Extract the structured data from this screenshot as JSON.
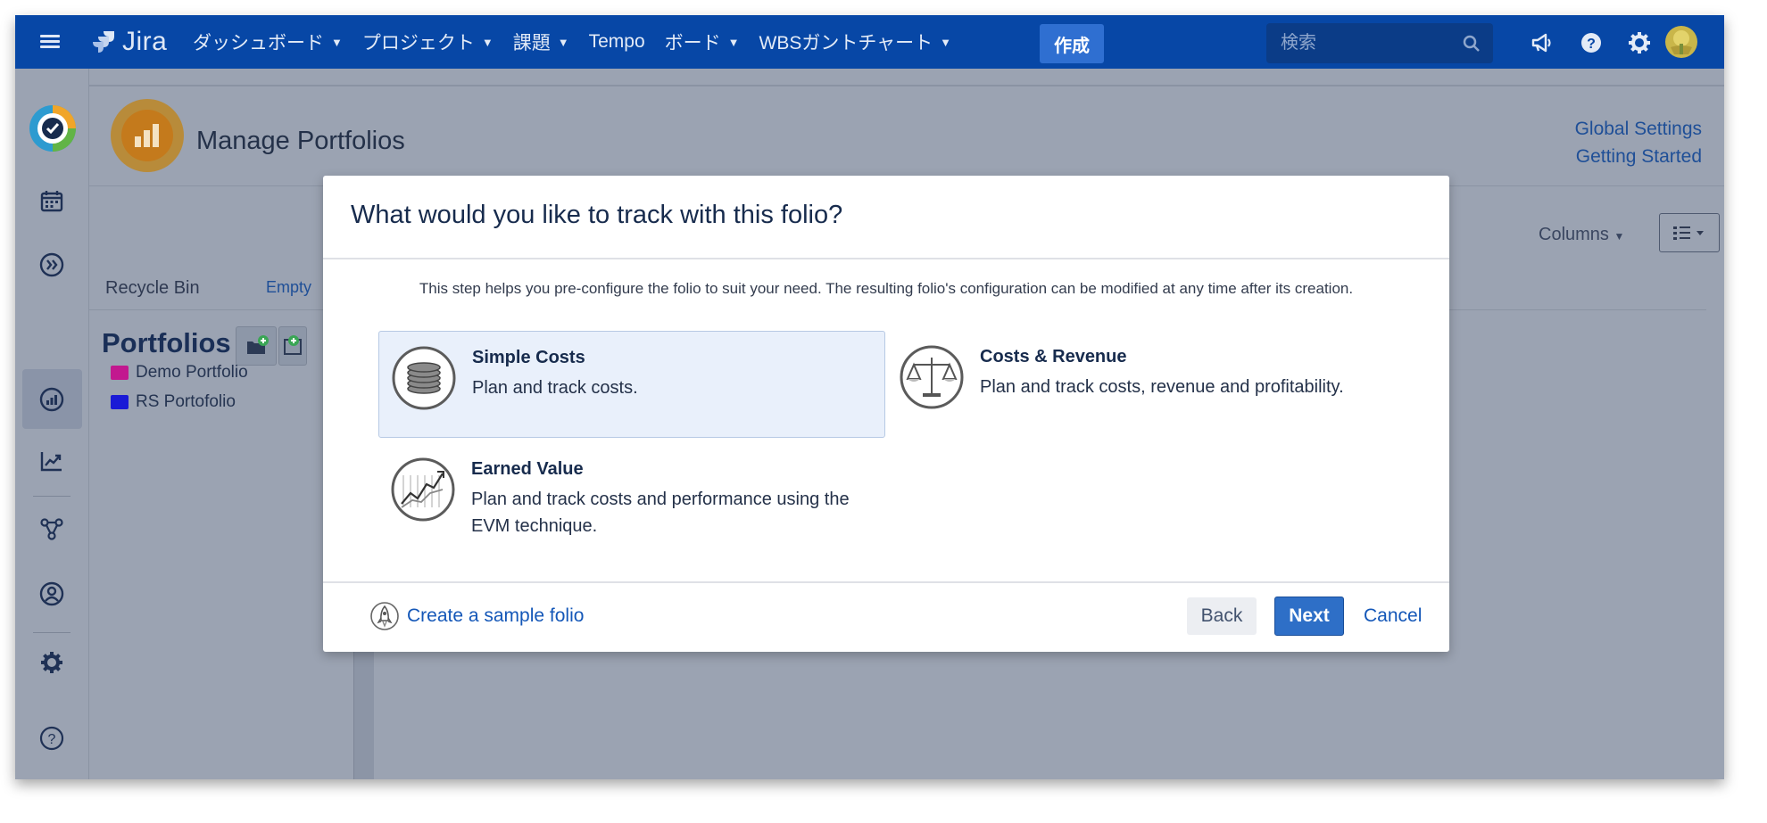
{
  "topnav": {
    "logo_text": "Jira",
    "items": [
      {
        "label": "ダッシュボード",
        "has_menu": true
      },
      {
        "label": "プロジェクト",
        "has_menu": true
      },
      {
        "label": "課題",
        "has_menu": true
      },
      {
        "label": "Tempo",
        "has_menu": false
      },
      {
        "label": "ボード",
        "has_menu": true
      },
      {
        "label": "WBSガントチャート",
        "has_menu": true
      }
    ],
    "create_label": "作成",
    "search_placeholder": "検索",
    "accent": "#0747a6"
  },
  "header": {
    "title": "Manage Portfolios",
    "links": [
      "Global Settings",
      "Getting Started"
    ]
  },
  "toolbar": {
    "columns_label": "Columns"
  },
  "left_panel": {
    "recycle_bin": "Recycle Bin",
    "empty_link": "Empty",
    "heading": "Portfolios",
    "tree": [
      {
        "label": "Demo Portfolio",
        "color": "#c2188f"
      },
      {
        "label": "RS Portofolio",
        "color": "#1a1ad6"
      }
    ]
  },
  "dialog": {
    "title": "What would you like to track with this folio?",
    "description": "This step helps you pre-configure the folio to suit your need. The resulting folio's configuration can be modified at any time after its creation.",
    "options": [
      {
        "title": "Simple Costs",
        "desc": "Plan and track costs.",
        "icon": "coins-icon",
        "selected": true
      },
      {
        "title": "Costs & Revenue",
        "desc": "Plan and track costs, revenue and profitability.",
        "icon": "scale-icon",
        "selected": false
      },
      {
        "title": "Earned Value",
        "desc": "Plan and track costs and performance using the EVM technique.",
        "icon": "trend-chart-icon",
        "selected": false
      }
    ],
    "sample_link": "Create a sample folio",
    "back_label": "Back",
    "next_label": "Next",
    "cancel_label": "Cancel"
  }
}
